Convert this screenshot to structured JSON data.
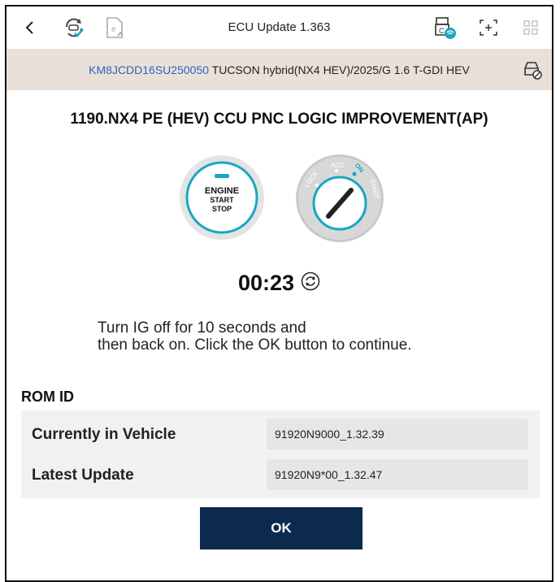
{
  "header": {
    "title": "ECU Update 1.363"
  },
  "vehicle": {
    "vin": "KM8JCDD16SU250050",
    "model": "TUCSON hybrid(NX4 HEV)/2025/G 1.6 T-GDI HEV"
  },
  "update": {
    "title": "1190.NX4 PE (HEV) CCU PNC LOGIC IMPROVEMENT(AP)",
    "timer": "00:23",
    "instruction_line1": "Turn IG off for 10 seconds and",
    "instruction_line2": "then back on. Click the OK button to continue."
  },
  "engine_button": {
    "line1": "ENGINE",
    "line2": "START",
    "line3": "STOP"
  },
  "ignition": {
    "lock": "LOCK",
    "acc": "ACC",
    "on": "ON",
    "start": "START"
  },
  "rom": {
    "title": "ROM ID",
    "rows": [
      {
        "label": "Currently in Vehicle",
        "value": "91920N9000_1.32.39"
      },
      {
        "label": "Latest Update",
        "value": "91920N9*00_1.32.47"
      }
    ]
  },
  "ok_label": "OK",
  "colors": {
    "accent": "#2f63b8",
    "teal": "#1aa6c4",
    "ok_button": "#0c2a4d",
    "vehicle_bar": "#e9e1d9"
  },
  "icons": [
    "back-icon",
    "update-vehicle-icon",
    "e-document-icon",
    "wireless-vci-icon",
    "screen-capture-icon",
    "grid-menu-icon",
    "car-diagnose-icon",
    "refresh-icon"
  ]
}
